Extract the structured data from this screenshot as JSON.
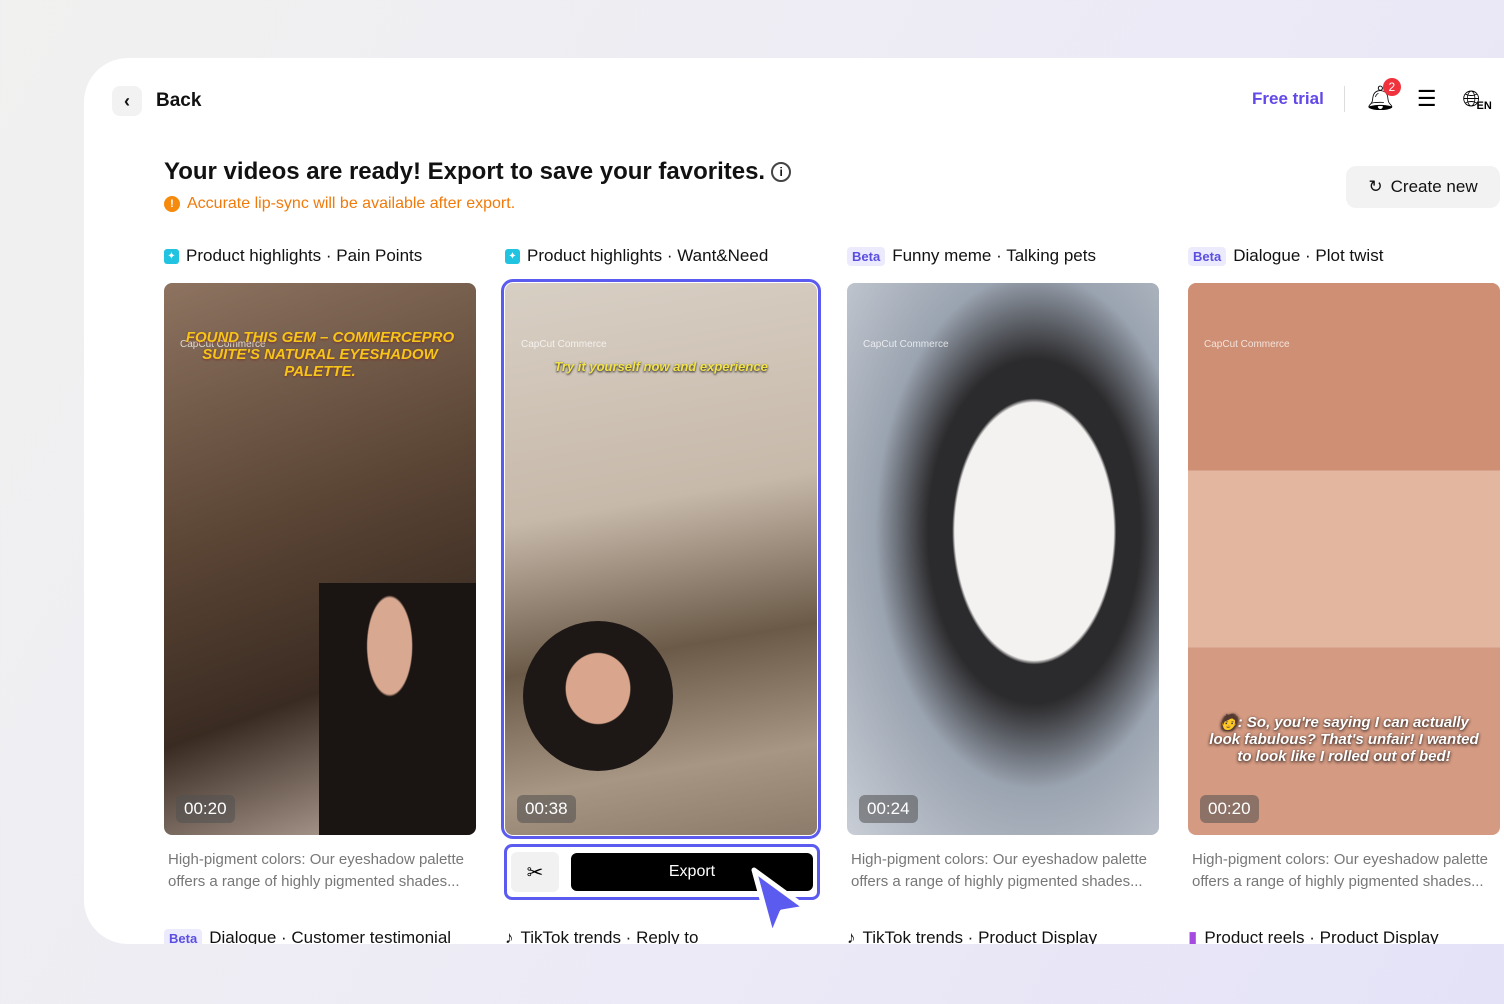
{
  "header": {
    "back_label": "Back",
    "free_trial": "Free trial",
    "notification_count": "2",
    "language": "EN"
  },
  "main": {
    "title": "Your videos are ready! Export to save your favorites.",
    "warning": "Accurate lip-sync will be available after export.",
    "create_new": "Create new"
  },
  "watermark": "CapCut Commerce",
  "cards": [
    {
      "badge": "",
      "category": "Product highlights · Pain Points",
      "duration": "00:20",
      "caption": "FOUND THIS GEM – COMMERCEPRO SUITE'S NATURAL EYESHADOW PALETTE.",
      "description": "High-pigment colors: Our eyeshadow palette offers a range of highly pigmented shades..."
    },
    {
      "badge": "",
      "category": "Product highlights · Want&Need",
      "duration": "00:38",
      "caption": "Try it yourself now and experience",
      "selected": true
    },
    {
      "badge": "Beta",
      "category": "Funny meme · Talking pets",
      "duration": "00:24",
      "caption": "",
      "description": "High-pigment colors: Our eyeshadow palette offers a range of highly pigmented shades..."
    },
    {
      "badge": "Beta",
      "category": "Dialogue · Plot twist",
      "duration": "00:20",
      "caption": "🧑: So, you're saying I can actually look fabulous? That's unfair! I wanted to look like I rolled out of bed!",
      "description": "High-pigment colors: Our eyeshadow palette offers a range of highly pigmented shades..."
    }
  ],
  "next_row": [
    {
      "badge": "Beta",
      "category": "Dialogue · Customer testimonial"
    },
    {
      "badge": "",
      "category": "TikTok trends · Reply to"
    },
    {
      "badge": "",
      "category": "TikTok trends · Product Display"
    },
    {
      "badge": "",
      "category": "Product reels · Product Display"
    }
  ],
  "export_bar": {
    "export_label": "Export"
  },
  "colors": {
    "accent": "#5b5bf0",
    "brand": "#6248e8",
    "warning": "#f07a0a"
  }
}
